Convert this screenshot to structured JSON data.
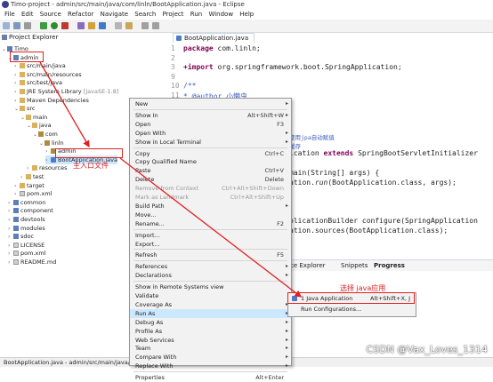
{
  "window": {
    "title": "Timo-project - admin/src/main/java/com/linln/BootApplication.java - Eclipse"
  },
  "menubar": [
    "File",
    "Edit",
    "Source",
    "Refactor",
    "Navigate",
    "Search",
    "Project",
    "Run",
    "Window",
    "Help"
  ],
  "project_explorer": {
    "title": "Project Explorer",
    "tree": [
      {
        "label": "Timo",
        "indent": 0
      },
      {
        "label": "admin",
        "indent": 1
      },
      {
        "label": "src/main/java",
        "indent": 2
      },
      {
        "label": "src/main/resources",
        "indent": 2
      },
      {
        "label": "src/test/java",
        "indent": 2
      },
      {
        "label": "JRE System Library",
        "suffix": "[JavaSE-1.8]",
        "indent": 2
      },
      {
        "label": "Maven Dependencies",
        "indent": 2
      },
      {
        "label": "src",
        "indent": 2
      },
      {
        "label": "main",
        "indent": 3
      },
      {
        "label": "java",
        "indent": 4
      },
      {
        "label": "com",
        "indent": 5
      },
      {
        "label": "linln",
        "indent": 6
      },
      {
        "label": "admin",
        "indent": 7
      },
      {
        "label": "BootApplication.java",
        "indent": 7
      },
      {
        "label": "resources",
        "indent": 4
      },
      {
        "label": "test",
        "indent": 3
      },
      {
        "label": "target",
        "indent": 2
      },
      {
        "label": "pom.xml",
        "indent": 2
      },
      {
        "label": "common",
        "indent": 1
      },
      {
        "label": "component",
        "indent": 1
      },
      {
        "label": "devtools",
        "indent": 1
      },
      {
        "label": "modules",
        "indent": 1
      },
      {
        "label": "sdoc",
        "indent": 1
      },
      {
        "label": "LICENSE",
        "indent": 1
      },
      {
        "label": "pom.xml",
        "indent": 1
      },
      {
        "label": "README.md",
        "indent": 1
      }
    ]
  },
  "editor": {
    "tab": "BootApplication.java",
    "lines": [
      {
        "n": "1",
        "pre": "",
        "kw": "package",
        "rest": " com.linln;"
      },
      {
        "n": "2",
        "pre": "",
        "kw": "",
        "rest": ""
      },
      {
        "n": "3",
        "pre": "",
        "kw": "+import",
        "rest": " org.springframework.boot.SpringApplication;"
      },
      {
        "n": "9",
        "pre": "",
        "kw": "",
        "rest": ""
      },
      {
        "n": "10",
        "pre": "",
        "kw": "",
        "rest": "/**"
      },
      {
        "n": "11",
        "pre": "",
        "kw": "",
        "rest": " * @author 小懒虫"
      }
    ],
    "frag_comment1": "使用jpa自动赋值",
    "frag_comment2": "缓存",
    "frag_class_kw": "extends",
    "frag_class_a": "ication ",
    "frag_class_b": " SpringBootServletInitializer",
    "frag_main": " main(String[] args) {",
    "frag_run_a": "ation.",
    "frag_run_b": "run",
    "frag_run_c": "(BootApplication.class, args);",
    "frag_builder": "plicationBuilder configure(SpringApplication",
    "frag_sources": "ation.sources(BootApplication.class);"
  },
  "bottom_tabs": {
    "items": [
      "ce Explorer",
      "Snippets",
      "Progress"
    ]
  },
  "status": {
    "path": "BootApplication.java - admin/src/main/java/com/"
  },
  "context_menu": {
    "items": [
      {
        "label": "New",
        "sub": true
      },
      {
        "sep": true
      },
      {
        "label": "Show In",
        "shortcut": "Alt+Shift+W",
        "sub": true
      },
      {
        "label": "Open",
        "shortcut": "F3"
      },
      {
        "label": "Open With",
        "sub": true
      },
      {
        "label": "Show in Local Terminal",
        "sub": true
      },
      {
        "sep": true
      },
      {
        "label": "Copy",
        "shortcut": "Ctrl+C"
      },
      {
        "label": "Copy Qualified Name"
      },
      {
        "label": "Paste",
        "shortcut": "Ctrl+V"
      },
      {
        "label": "Delete",
        "shortcut": "Delete"
      },
      {
        "label": "Remove from Context",
        "shortcut": "Ctrl+Alt+Shift+Down",
        "disabled": true
      },
      {
        "label": "Mark as Landmark",
        "shortcut": "Ctrl+Alt+Shift+Up",
        "disabled": true
      },
      {
        "label": "Build Path",
        "sub": true
      },
      {
        "label": "Move..."
      },
      {
        "label": "Rename...",
        "shortcut": "F2"
      },
      {
        "sep": true
      },
      {
        "label": "Import..."
      },
      {
        "label": "Export..."
      },
      {
        "sep": true
      },
      {
        "label": "Refresh",
        "shortcut": "F5"
      },
      {
        "sep": true
      },
      {
        "label": "References",
        "sub": true
      },
      {
        "label": "Declarations",
        "sub": true
      },
      {
        "sep": true
      },
      {
        "label": "Show in Remote Systems view"
      },
      {
        "label": "Validate"
      },
      {
        "label": "Coverage As",
        "sub": true
      },
      {
        "label": "Run As",
        "sub": true,
        "highlight": true
      },
      {
        "label": "Debug As",
        "sub": true
      },
      {
        "label": "Profile As",
        "sub": true
      },
      {
        "label": "Web Services",
        "sub": true
      },
      {
        "label": "Team",
        "sub": true
      },
      {
        "label": "Compare With",
        "sub": true
      },
      {
        "label": "Replace With",
        "sub": true
      },
      {
        "sep": true
      },
      {
        "label": "Properties",
        "shortcut": "Alt+Enter"
      }
    ]
  },
  "run_as_submenu": {
    "items": [
      {
        "label": "1 Java Application",
        "shortcut": "Alt+Shift+X, J"
      },
      {
        "label": "Run Configurations..."
      }
    ]
  },
  "annotations": {
    "main_entry": "主入口文件",
    "choose_java_app": "选择 java应用",
    "color": "#e02020"
  },
  "watermark": "CSDN @Vax_Loves_1314"
}
